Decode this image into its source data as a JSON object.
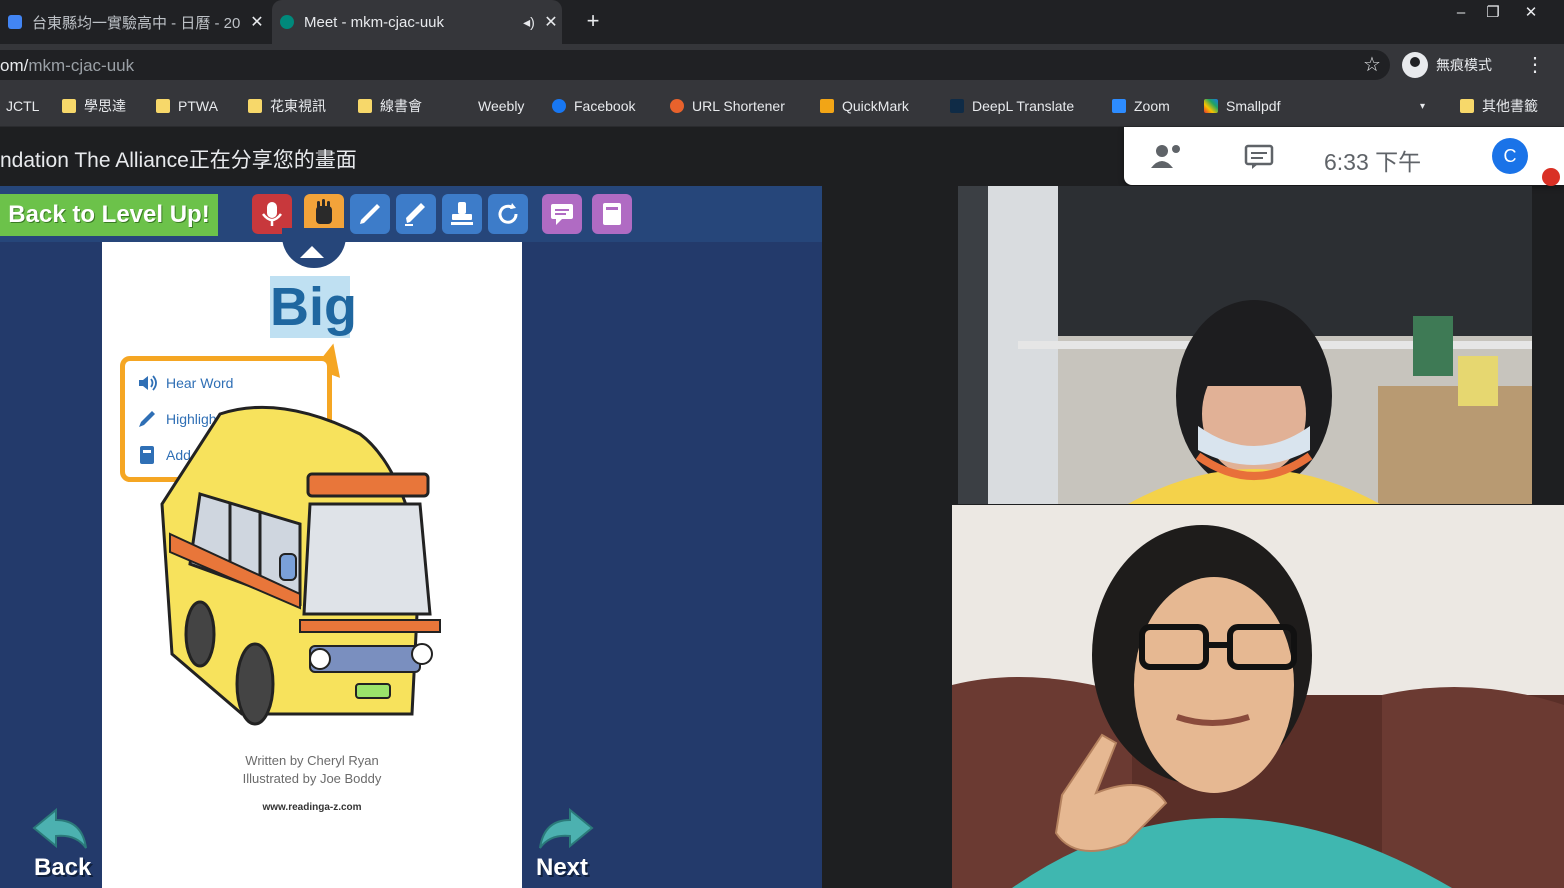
{
  "tabs": [
    {
      "title": "台東縣均一實驗高中 - 日曆 - 20",
      "favicon_color": "#4285f4",
      "active": false
    },
    {
      "title": "Meet - mkm-cjac-uuk",
      "favicon_color": "#00897b",
      "active": true
    }
  ],
  "window_controls": {
    "minimize": "–",
    "restore": "❐",
    "close": "✕"
  },
  "address_bar": {
    "url_prefix": "om/",
    "url_path": "mkm-cjac-uuk"
  },
  "profile": {
    "label": "無痕模式"
  },
  "bookmarks": [
    {
      "label": "JCTL",
      "icon": "none"
    },
    {
      "label": "學思達",
      "icon": "folder"
    },
    {
      "label": "PTWA",
      "icon": "folder"
    },
    {
      "label": "花東視訊",
      "icon": "folder"
    },
    {
      "label": "線書會",
      "icon": "folder"
    },
    {
      "label": "Weebly",
      "icon": "none"
    },
    {
      "label": "Facebook",
      "icon": "facebook-icon"
    },
    {
      "label": "URL Shortener",
      "icon": "url-shortener-icon"
    },
    {
      "label": "QuickMark",
      "icon": "quickmark-icon"
    },
    {
      "label": "DeepL Translate",
      "icon": "deepl-icon"
    },
    {
      "label": "Zoom",
      "icon": "zoom-icon"
    },
    {
      "label": "Smallpdf",
      "icon": "smallpdf-icon"
    }
  ],
  "other_bookmarks": "其他書籤",
  "meet": {
    "presenting_text": "ndation The Alliance正在分享您的畫面",
    "clock": "6:33  下午",
    "avatar_letter": "C"
  },
  "shared_screen": {
    "back_to_level_label": "Back to Level Up!",
    "word": "Big",
    "popup_items": [
      "Hear Word",
      "Highlight",
      "Add to Word Journal"
    ],
    "credits_line1": "Written by Cheryl Ryan",
    "credits_line2": "Illustrated by Joe Boddy",
    "website": "www.readinga-z.com",
    "back_label": "Back",
    "next_label": "Next",
    "tool_icons": [
      "microphone-icon",
      "hand-icon",
      "pencil-icon",
      "highlighter-icon",
      "stamp-icon",
      "refresh-icon",
      "comment-icon",
      "journal-icon"
    ]
  },
  "colors": {
    "chrome_dark": "#202124",
    "meet_blue": "#1a73e8",
    "level_up_green": "#6cc24a",
    "screen_navy": "#233a6b",
    "popup_orange": "#f5a623"
  }
}
